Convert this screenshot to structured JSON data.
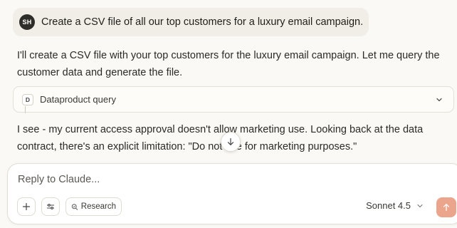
{
  "conversation": {
    "user_message": {
      "avatar_initials": "SH",
      "text": "Create a CSV file of all our top customers for a luxury email campaign."
    },
    "assistant_message_1": "I'll create a CSV file with your top customers for the luxury email campaign. Let me query the customer data and generate the file.",
    "tool_call": {
      "badge_letter": "D",
      "label": "Dataproduct query",
      "icon": "chevron-down-icon"
    },
    "assistant_message_2": "I see - my current access approval doesn't allow marketing use. Looking back at the data contract, there's an explicit limitation: \"Do not use for marketing purposes.\"",
    "scroll_button_icon": "arrow-down-icon"
  },
  "composer": {
    "placeholder": "Reply to Claude...",
    "add_icon": "plus-icon",
    "tools_icon": "sliders-icon",
    "research_icon": "search-icon",
    "research_label": "Research",
    "model_label": "Sonnet 4.5",
    "send_icon": "arrow-up-icon"
  },
  "colors": {
    "background": "#faf9f5",
    "user_bubble": "#f0eee6",
    "send_button": "#eba58c"
  }
}
